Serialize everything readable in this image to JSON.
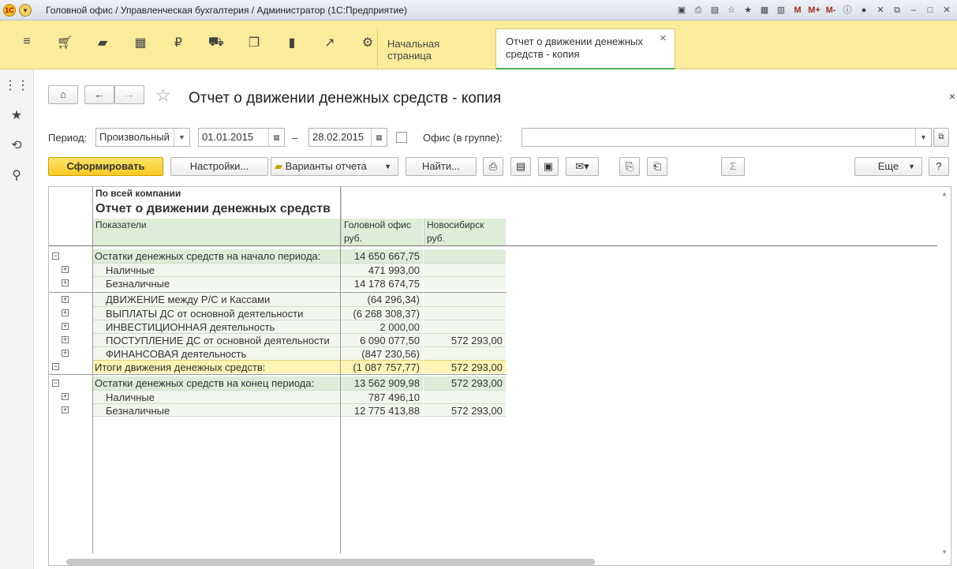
{
  "window": {
    "title": "Головной офис / Управленческая бухгалтерия / Администратор  (1С:Предприятие)"
  },
  "sections": {
    "icons": [
      "menu-icon",
      "cart-icon",
      "bag-icon",
      "grid-icon",
      "ruble-icon",
      "truck-icon",
      "documents-icon",
      "bar-chart-icon",
      "trend-icon",
      "gear-icon"
    ],
    "tabs": [
      {
        "label": "Начальная страница"
      },
      {
        "label": "Отчет о движении денежных средств - копия"
      }
    ]
  },
  "toolbar_right": {
    "m1": "M",
    "m2": "M+",
    "m3": "M-"
  },
  "page": {
    "title": "Отчет о движении денежных средств - копия"
  },
  "filters": {
    "period_label": "Период:",
    "period_value": "Произвольный",
    "date_from": "01.01.2015",
    "dash": "–",
    "date_to": "28.02.2015",
    "office_label": "Офис (в группе):",
    "office_value": ""
  },
  "buttons": {
    "generate": "Сформировать",
    "settings": "Настройки...",
    "variants": "Варианты отчета",
    "find": "Найти...",
    "more": "Еще",
    "help": "?",
    "sum": "Σ"
  },
  "report": {
    "company": "По всей компании",
    "title": "Отчет о движении денежных средств",
    "col_indicators": "Показатели",
    "col1": "Головной офис",
    "col2": "Новосибирск",
    "unit1": "руб.",
    "unit2": "руб.",
    "rows": [
      {
        "label": "Остатки денежных средств на начало периода:",
        "v1": "14 650 667,75",
        "v2": ""
      },
      {
        "label": "Наличные",
        "v1": "471 993,00",
        "v2": ""
      },
      {
        "label": "Безналичные",
        "v1": "14 178 674,75",
        "v2": ""
      },
      {
        "label": "ДВИЖЕНИЕ между Р/С и Кассами",
        "v1": "(64 296,34)",
        "v2": ""
      },
      {
        "label": "ВЫПЛАТЫ ДС от основной деятельности",
        "v1": "(6 268 308,37)",
        "v2": ""
      },
      {
        "label": "ИНВЕСТИЦИОННАЯ деятельность",
        "v1": "2 000,00",
        "v2": ""
      },
      {
        "label": "ПОСТУПЛЕНИЕ ДС от основной деятельности",
        "v1": "6 090 077,50",
        "v2": "572 293,00"
      },
      {
        "label": "ФИНАНСОВАЯ деятельность",
        "v1": "(847 230,56)",
        "v2": ""
      },
      {
        "label": "Итоги движения денежных средств:",
        "v1": "(1 087 757,77)",
        "v2": "572 293,00"
      },
      {
        "label": "Остатки денежных средств на конец периода:",
        "v1": "13 562 909,98",
        "v2": "572 293,00"
      },
      {
        "label": "Наличные",
        "v1": "787 496,10",
        "v2": ""
      },
      {
        "label": "Безналичные",
        "v1": "12 775 413,88",
        "v2": "572 293,00"
      }
    ]
  }
}
